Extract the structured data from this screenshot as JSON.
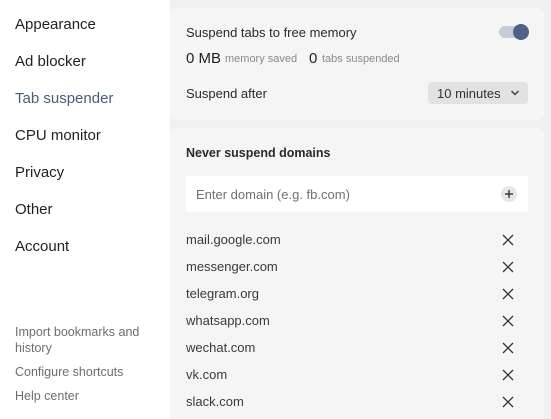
{
  "sidebar": {
    "items": [
      {
        "label": "Appearance"
      },
      {
        "label": "Ad blocker"
      },
      {
        "label": "Tab suspender"
      },
      {
        "label": "CPU monitor"
      },
      {
        "label": "Privacy"
      },
      {
        "label": "Other"
      },
      {
        "label": "Account"
      }
    ],
    "active": "Tab suspender",
    "footer": {
      "import_label": "Import bookmarks and history",
      "shortcuts_label": "Configure shortcuts",
      "help_label": "Help center"
    }
  },
  "suspender": {
    "toggle_label": "Suspend tabs to free memory",
    "toggle_on": true,
    "memory_value": "0 MB",
    "memory_caption": "memory saved",
    "tabs_value": "0",
    "tabs_caption": "tabs suspended",
    "suspend_after_label": "Suspend after",
    "suspend_after_value": "10 minutes"
  },
  "never_suspend": {
    "title": "Never suspend domains",
    "input_placeholder": "Enter domain (e.g. fb.com)",
    "domains": [
      "mail.google.com",
      "messenger.com",
      "telegram.org",
      "whatsapp.com",
      "wechat.com",
      "vk.com",
      "slack.com"
    ]
  },
  "colors": {
    "accent": "#4e6189",
    "active_nav": "#4a5a78",
    "panel_bg": "#f0f0f0"
  },
  "icons": {
    "toggle": "toggle-switch",
    "dropdown": "chevron-down-icon",
    "add": "plus-circle-icon",
    "remove": "close-icon"
  }
}
